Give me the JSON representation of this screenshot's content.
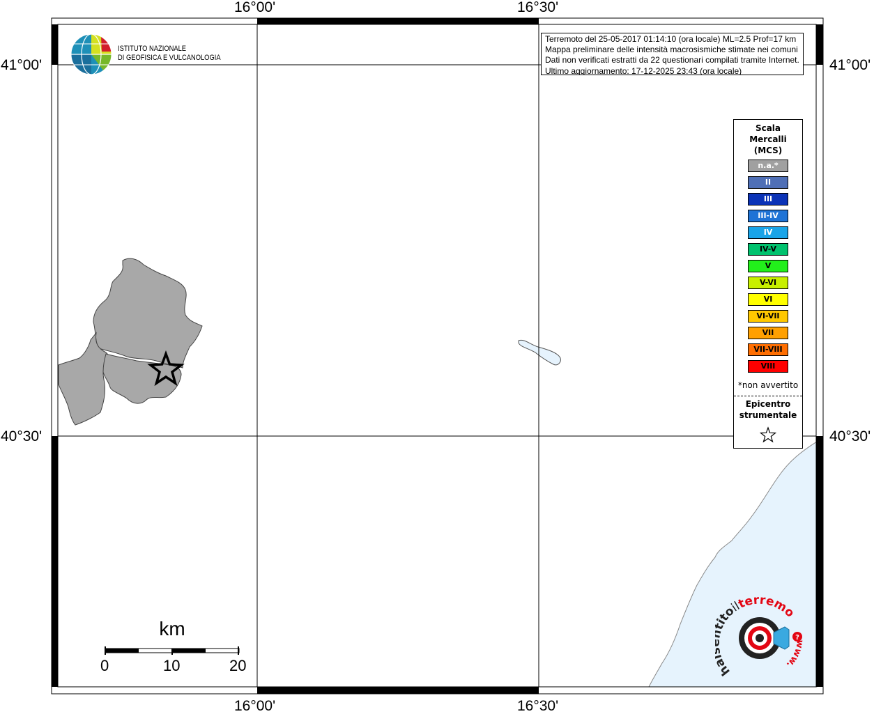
{
  "coords": {
    "top": [
      "16°00'",
      "16°30'"
    ],
    "bottom": [
      "16°00'",
      "16°30'"
    ],
    "left": [
      "41°00'",
      "40°30'"
    ],
    "right": [
      "41°00'",
      "40°30'"
    ]
  },
  "logo": {
    "line1": "ISTITUTO NAZIONALE",
    "line2": "DI GEOFISICA E VULCANOLOGIA"
  },
  "info": {
    "line1": "Terremoto del 25-05-2017 01:14:10 (ora locale) ML=2.5 Prof=17 km",
    "line2": "Mappa preliminare delle intensità macrosismiche stimate nei comuni",
    "line3": "Dati non verificati estratti da 22 questionari compilati tramite Internet.",
    "line4": "Ultimo aggiornamento: 17-12-2025 23:43 (ora locale)"
  },
  "legend": {
    "title": [
      "Scala",
      "Mercalli",
      "(MCS)"
    ],
    "items": [
      {
        "label": "n.a.*",
        "color": "#a0a0a0",
        "text_color": "#ffffff"
      },
      {
        "label": "II",
        "color": "#4f6fb6",
        "text_color": "#ffffff"
      },
      {
        "label": "III",
        "color": "#0b33b7",
        "text_color": "#ffffff"
      },
      {
        "label": "III-IV",
        "color": "#1e73d6",
        "text_color": "#ffffff"
      },
      {
        "label": "IV",
        "color": "#19a4e8",
        "text_color": "#ffffff"
      },
      {
        "label": "IV-V",
        "color": "#00c26e",
        "text_color": "#000000"
      },
      {
        "label": "V",
        "color": "#22ef1b",
        "text_color": "#000000"
      },
      {
        "label": "V-VI",
        "color": "#c8f000",
        "text_color": "#000000"
      },
      {
        "label": "VI",
        "color": "#ffff00",
        "text_color": "#000000"
      },
      {
        "label": "VI-VII",
        "color": "#ffc800",
        "text_color": "#000000"
      },
      {
        "label": "VII",
        "color": "#ffa000",
        "text_color": "#000000"
      },
      {
        "label": "VII-VIII",
        "color": "#ff6e00",
        "text_color": "#000000"
      },
      {
        "label": "VIII",
        "color": "#ff0000",
        "text_color": "#000000"
      }
    ],
    "note": "*non avvertito",
    "epicentre": [
      "Epicentro",
      "strumentale"
    ]
  },
  "scale_bar": {
    "title": "km",
    "ticks": [
      "0",
      "10",
      "20"
    ]
  },
  "watermark": {
    "text1": "haisentito",
    "text2": "il",
    "text3": "terremoto.it",
    "text4": "www."
  },
  "colors": {
    "municipality": "#a8a8a8",
    "water": "#e6f3fd",
    "border": "#000000"
  }
}
